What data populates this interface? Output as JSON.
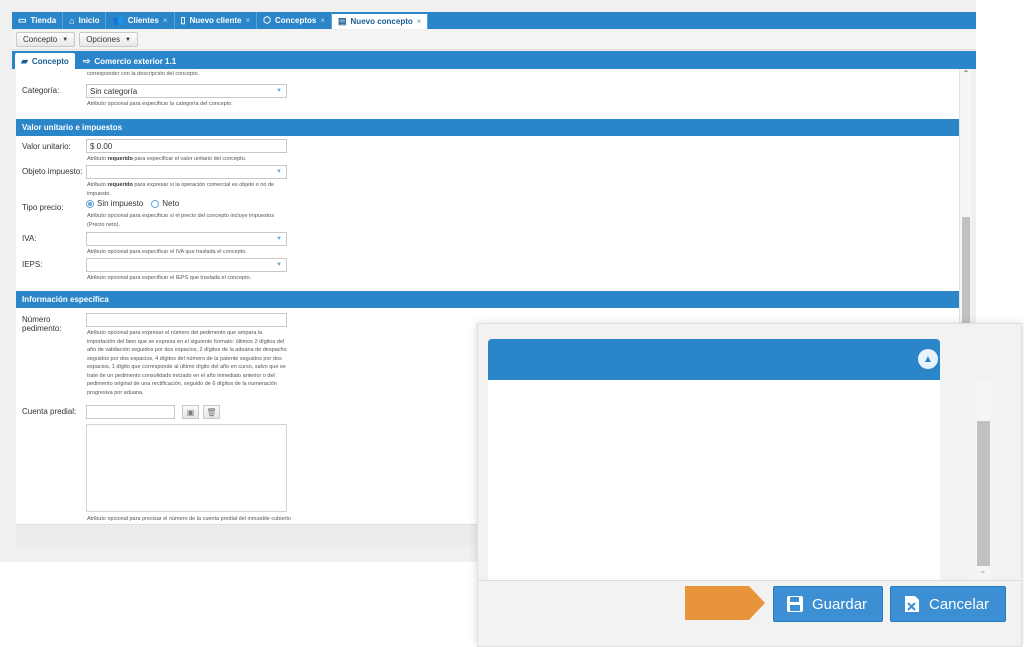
{
  "tabs": [
    {
      "label": "Tienda",
      "icon": "▭",
      "closable": false
    },
    {
      "label": "Inicio",
      "icon": "⌂",
      "closable": false
    },
    {
      "label": "Clientes",
      "icon": "👥",
      "closable": true
    },
    {
      "label": "Nuevo cliente",
      "icon": "▯",
      "closable": true
    },
    {
      "label": "Conceptos",
      "icon": "⬡",
      "closable": true
    },
    {
      "label": "Nuevo concepto",
      "icon": "▤",
      "closable": true
    }
  ],
  "tab_close": "×",
  "menu": {
    "concepto": "Concepto",
    "opciones": "Opciones",
    "caret": "▼"
  },
  "subtabs": {
    "concepto": "Concepto",
    "comercio": "Comercio exterior 1.1"
  },
  "form": {
    "top_help": "corresponder con la descripción del concepto.",
    "categoria": {
      "label": "Categoría:",
      "value": "Sin categoría",
      "help": "Atributo opcional para especificar la categoría del concepto."
    },
    "section1": "Valor unitario e impuestos",
    "valor_unitario": {
      "label": "Valor unitario:",
      "value": "$ 0.00",
      "help_pre": "Atributo ",
      "help_bold": "requerido",
      "help_post": " para especificar el valor unitario del concepto."
    },
    "objeto_impuesto": {
      "label": "Objeto impuesto:",
      "value": "",
      "help_pre": "Atributo ",
      "help_bold": "requerido",
      "help_post": " para expresar si la operación comercial es objeto o no de impuesto."
    },
    "tipo_precio": {
      "label": "Tipo precio:",
      "opt1": "Sin impuesto",
      "opt2": "Neto",
      "help": "Atributo opcional para especificar si el precio del concepto incluye impuestos (Precio neto)."
    },
    "iva": {
      "label": "IVA:",
      "help": "Atributo opcional para especificar el IVA que traslada el concepto."
    },
    "ieps": {
      "label": "IEPS:",
      "help": "Atributo opcional para especificar el IEPS que traslada el concepto."
    },
    "section2": "Información específica",
    "numero_pedimento": {
      "label": "Número pedimento:",
      "help": "Atributo opcional para expresar el número del pedimento que ampara la importación del bien que se expresa en el siguiente formato: últimos 2 dígitos del año de validación seguidos por dos espacios, 2 dígitos de la aduana de despacho seguidos por dos espacios, 4 dígitos del número de la patente seguidos por dos espacios, 1 dígito que corresponde al último dígito del año en curso, salvo que se trate de un pedimento consolidado iniciado en el año inmediato anterior o del pedimento original de una rectificación, seguido de 6 dígitos de la numeración progresiva por aduana."
    },
    "cuenta_predial": {
      "label": "Cuenta predial:",
      "help": "Atributo opcional para precisar el número de la cuenta predial del inmueble cubierto"
    }
  },
  "zoom": {
    "guardar": "Guardar",
    "cancelar": "Cancelar"
  },
  "colors": {
    "accent": "#2a85c9",
    "button": "#3b8fd2",
    "arrow": "#e8943a"
  }
}
